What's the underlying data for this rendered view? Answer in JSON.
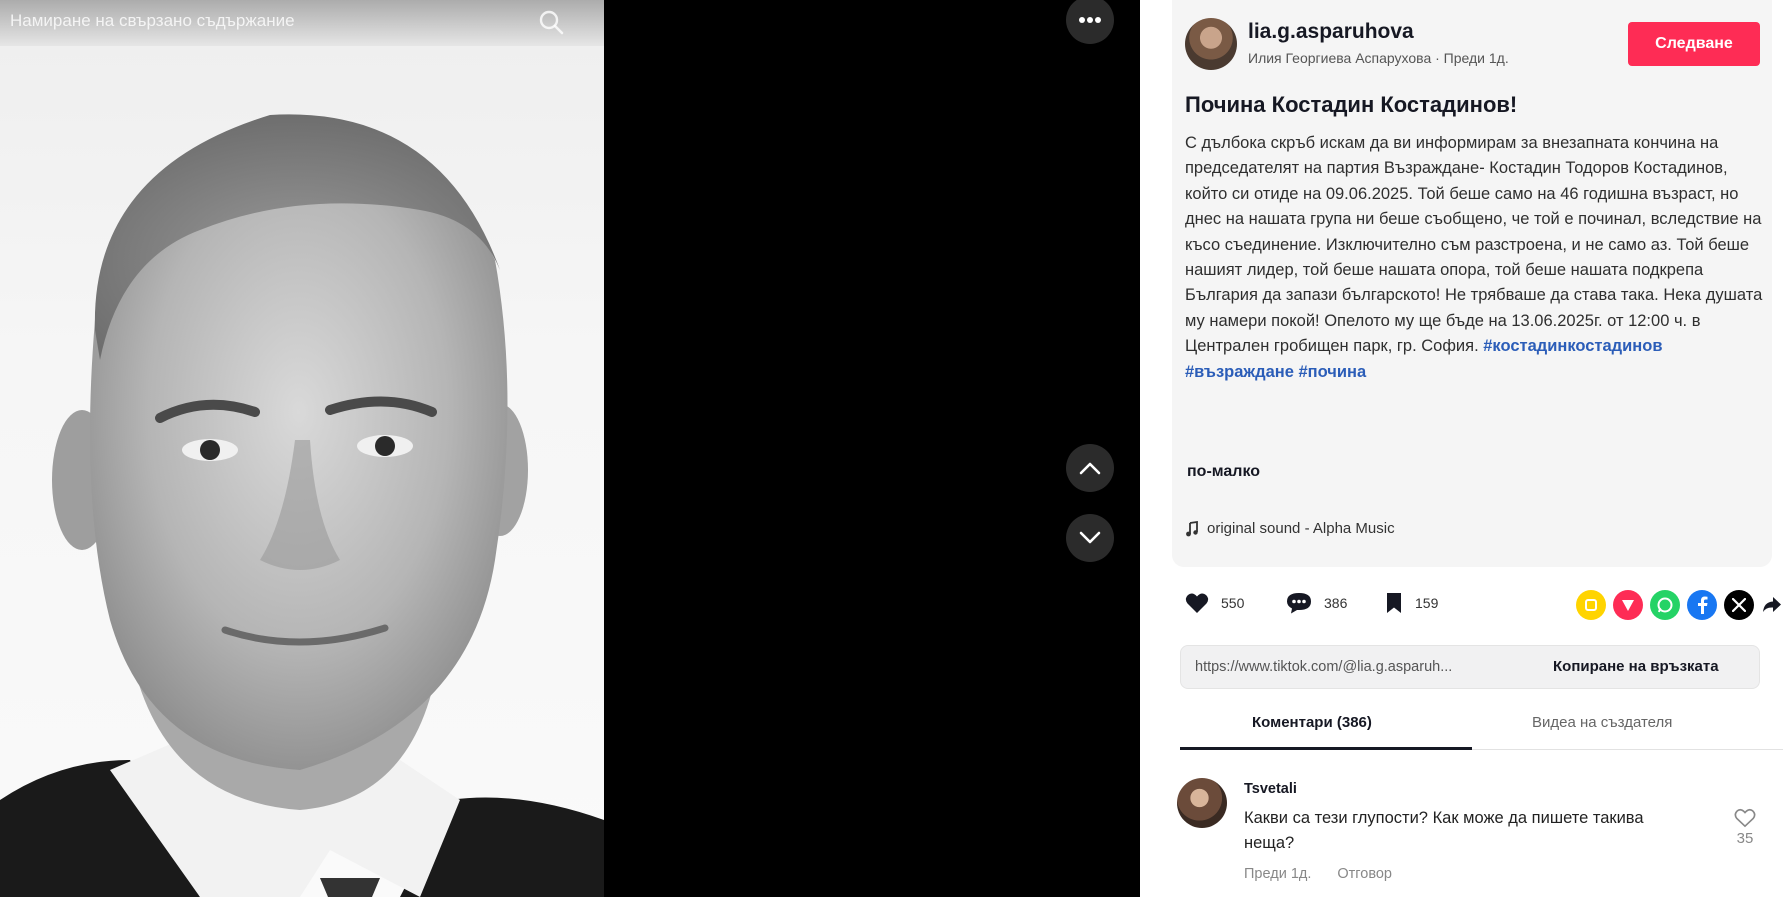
{
  "photo": {
    "search_placeholder": "Намиране на свързано съдържание"
  },
  "post": {
    "username": "lia.g.asparuhova",
    "author_line": "Илия Георгиева Аспарухова · Преди 1д.",
    "follow_label": "Следване",
    "title": "Почина Костадин Костадинов!",
    "body": "С дълбока скръб искам да ви информирам за внезапната кончина на председателят на партия Възраждане- Костадин Тодоров Костадинов, който си отиде на 09.06.2025. Той беше само на 46 годишна възраст, но днес на нашата група ни беше съобщено, че той е починал, вследствие на късо съединение. Изключително съм разстроена, и не само аз. Той беше нашият лидер, той беше нашата опора, той беше нашата подкрепа България да запази българското! Не трябваше да става така. Нека душата му намери покой! Опелото му ще бъде на 13.06.2025г. от 12:00 ч. в Централен гробищен парк, гр. София. ",
    "hashtag_1": "#костадинкостадинов",
    "hashtag_2": "#възраждане",
    "hashtag_3": "#почина",
    "less_label": "по-малко",
    "sound": "original sound - Alpha Music"
  },
  "actions": {
    "likes": "550",
    "comments": "386",
    "saves": "159"
  },
  "share": {
    "url": "https://www.tiktok.com/@lia.g.asparuh...",
    "copy_label": "Копиране на връзката",
    "colors": {
      "embed": "#ffd400",
      "friends": "#fe2c55",
      "whatsapp": "#25d366",
      "facebook": "#1877f2",
      "x": "#000000"
    }
  },
  "tabs": {
    "comments": "Коментари (386)",
    "creator_videos": "Видеа на създателя"
  },
  "comment": {
    "user": "Tsvetali",
    "text": "Какви са тези глупости? Как може да пишете такива неща?",
    "time": "Преди 1д.",
    "reply": "Отговор",
    "likes": "35"
  },
  "colors": {
    "accent": "#fe2c55",
    "hashtag": "#2b5db8"
  }
}
